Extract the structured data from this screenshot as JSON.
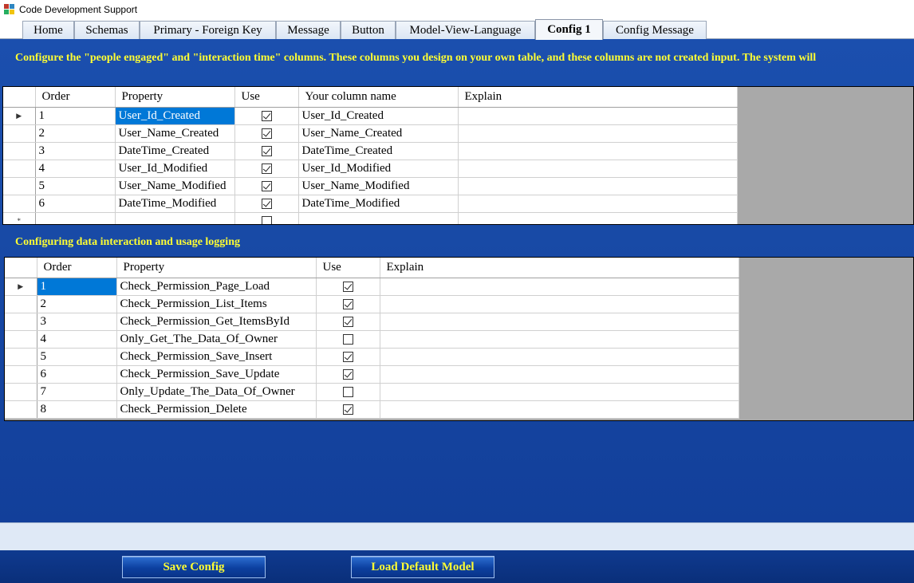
{
  "window": {
    "title": "Code Development Support"
  },
  "tabs": [
    {
      "label": "Home",
      "active": false
    },
    {
      "label": "Schemas",
      "active": false
    },
    {
      "label": "Primary - Foreign Key",
      "active": false
    },
    {
      "label": "Message",
      "active": false
    },
    {
      "label": "Button",
      "active": false
    },
    {
      "label": "Model-View-Language",
      "active": false
    },
    {
      "label": "Config 1",
      "active": true
    },
    {
      "label": "Config Message",
      "active": false
    }
  ],
  "section1": {
    "title": "Configure the \"people engaged\" and \"interaction time\" columns. These columns you design on your own table, and these columns are not created input. The system will"
  },
  "grid1": {
    "columns": [
      "Order",
      "Property",
      "Use",
      "Your column name",
      "Explain"
    ],
    "rows": [
      {
        "order": "1",
        "property": "User_Id_Created",
        "use": true,
        "column_name": "User_Id_Created",
        "explain": ""
      },
      {
        "order": "2",
        "property": "User_Name_Created",
        "use": true,
        "column_name": "User_Name_Created",
        "explain": ""
      },
      {
        "order": "3",
        "property": "DateTime_Created",
        "use": true,
        "column_name": "DateTime_Created",
        "explain": ""
      },
      {
        "order": "4",
        "property": "User_Id_Modified",
        "use": true,
        "column_name": "User_Id_Modified",
        "explain": ""
      },
      {
        "order": "5",
        "property": "User_Name_Modified",
        "use": true,
        "column_name": "User_Name_Modified",
        "explain": ""
      },
      {
        "order": "6",
        "property": "DateTime_Modified",
        "use": true,
        "column_name": "DateTime_Modified",
        "explain": ""
      }
    ],
    "new_row_marker": "*"
  },
  "section2": {
    "title": "Configuring data interaction and usage logging"
  },
  "grid2": {
    "columns": [
      "Order",
      "Property",
      "Use",
      "Explain"
    ],
    "rows": [
      {
        "order": "1",
        "property": "Check_Permission_Page_Load",
        "use": true,
        "explain": ""
      },
      {
        "order": "2",
        "property": "Check_Permission_List_Items",
        "use": true,
        "explain": ""
      },
      {
        "order": "3",
        "property": "Check_Permission_Get_ItemsById",
        "use": true,
        "explain": ""
      },
      {
        "order": "4",
        "property": "Only_Get_The_Data_Of_Owner",
        "use": false,
        "explain": ""
      },
      {
        "order": "5",
        "property": "Check_Permission_Save_Insert",
        "use": true,
        "explain": ""
      },
      {
        "order": "6",
        "property": "Check_Permission_Save_Update",
        "use": true,
        "explain": ""
      },
      {
        "order": "7",
        "property": "Only_Update_The_Data_Of_Owner",
        "use": false,
        "explain": ""
      },
      {
        "order": "8",
        "property": "Check_Permission_Delete",
        "use": true,
        "explain": ""
      }
    ]
  },
  "buttons": {
    "save": "Save  Config",
    "load_default": "Load Default Model"
  },
  "colors": {
    "panel_blue": "#184aa6",
    "title_yellow": "#ffff33",
    "selection_blue": "#0078d7",
    "grid_empty": "#a9a9a9"
  },
  "icons": {
    "row_pointer": "current-row-arrow",
    "checkbox": "checkbox"
  }
}
